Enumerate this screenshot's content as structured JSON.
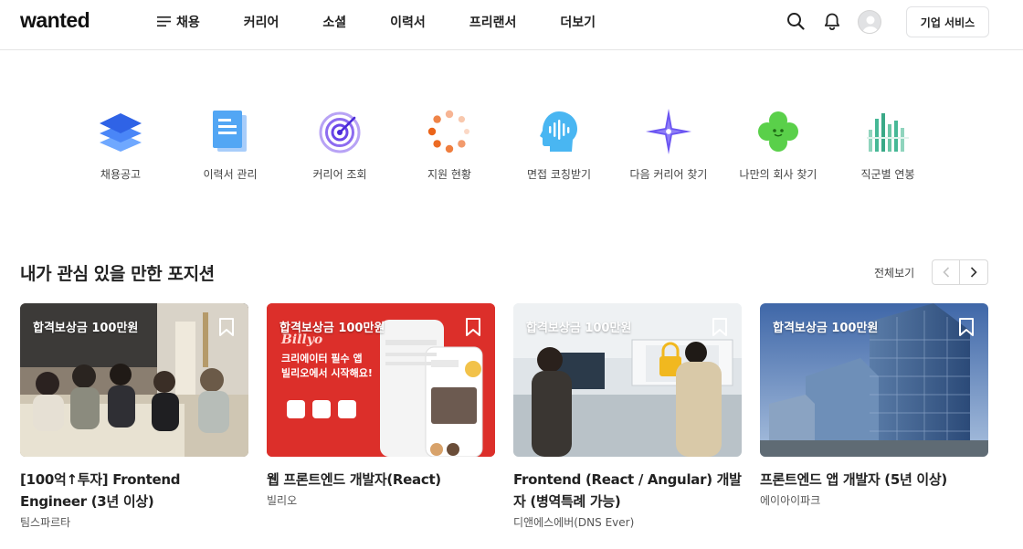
{
  "header": {
    "logo": "wanted",
    "nav": [
      {
        "label": "채용",
        "icon": "menu-icon"
      },
      {
        "label": "커리어"
      },
      {
        "label": "소셜"
      },
      {
        "label": "이력서"
      },
      {
        "label": "프리랜서"
      },
      {
        "label": "더보기"
      }
    ],
    "icons": [
      "search-icon",
      "bell-icon",
      "avatar"
    ],
    "business_button": "기업 서비스"
  },
  "quick_menu": [
    {
      "label": "채용공고",
      "icon": "layers-icon"
    },
    {
      "label": "이력서 관리",
      "icon": "document-icon"
    },
    {
      "label": "커리어 조회",
      "icon": "target-icon"
    },
    {
      "label": "지원 현황",
      "icon": "loading-dots-icon"
    },
    {
      "label": "면접 코칭받기",
      "icon": "voice-head-icon"
    },
    {
      "label": "다음 커리어 찾기",
      "icon": "compass-star-icon"
    },
    {
      "label": "나만의 회사 찾기",
      "icon": "clover-icon"
    },
    {
      "label": "직군별 연봉",
      "icon": "bar-chart-icon"
    }
  ],
  "section": {
    "title": "내가 관심 있을 만한 포지션",
    "see_all": "전체보기"
  },
  "cards": [
    {
      "badge": "합격보상금 100만원",
      "title": "[100억↑투자] Frontend Engineer (3년 이상)",
      "company": "팀스파르타"
    },
    {
      "badge": "합격보상금 100만원",
      "title": "웹 프론트엔드 개발자(React)",
      "company": "빌리오",
      "overlay_text": [
        "Billyo",
        "크리에이터 필수 앱",
        "빌리오에서 시작해요!"
      ]
    },
    {
      "badge": "합격보상금 100만원",
      "title": "Frontend (React / Angular) 개발자 (병역특례 가능)",
      "company": "디앤에스에버(DNS Ever)"
    },
    {
      "badge": "합격보상금 100만원",
      "title": "프론트엔드 앱 개발자 (5년 이상)",
      "company": "에이아이파크"
    }
  ]
}
